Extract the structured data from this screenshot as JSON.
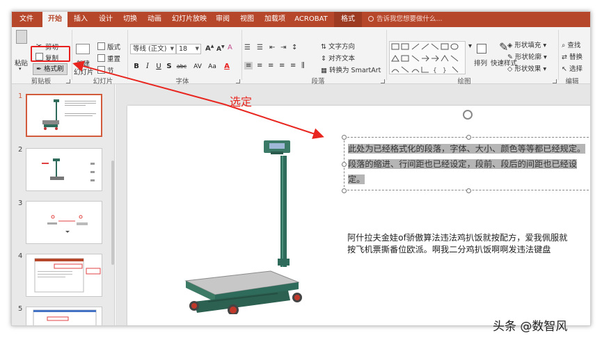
{
  "tabs": [
    {
      "id": "file",
      "label": "文件"
    },
    {
      "id": "home",
      "label": "开始"
    },
    {
      "id": "insert",
      "label": "插入"
    },
    {
      "id": "design",
      "label": "设计"
    },
    {
      "id": "transitions",
      "label": "切换"
    },
    {
      "id": "animations",
      "label": "动画"
    },
    {
      "id": "slideshow",
      "label": "幻灯片放映"
    },
    {
      "id": "review",
      "label": "审阅"
    },
    {
      "id": "view",
      "label": "视图"
    },
    {
      "id": "addins",
      "label": "加载项"
    },
    {
      "id": "acrobat",
      "label": "ACROBAT"
    },
    {
      "id": "format",
      "label": "格式"
    }
  ],
  "tell_me": "告诉我您想要做什么...",
  "clipboard": {
    "paste": "粘贴",
    "cut": "剪切",
    "copy": "复制",
    "format_painter": "格式刷",
    "group": "剪贴板"
  },
  "slides": {
    "new_slide": "新建",
    "new_slide2": "幻灯片",
    "layout": "版式",
    "reset": "重置",
    "section": "节",
    "group": "幻灯片"
  },
  "font": {
    "family": "等线 (正文)",
    "size": "18",
    "group": "字体"
  },
  "paragraph": {
    "text_direction": "文字方向",
    "align_text": "对齐文本",
    "smartart": "转换为 SmartArt",
    "group": "段落"
  },
  "drawing": {
    "arrange": "排列",
    "quick_styles": "快速样式",
    "shape_fill": "形状填充",
    "shape_outline": "形状轮廓",
    "shape_effects": "形状效果",
    "group": "绘图"
  },
  "editing": {
    "find": "查找",
    "replace": "替换",
    "select": "选择",
    "group": "编辑"
  },
  "thumbnails": [
    "1",
    "2",
    "3",
    "4",
    "5"
  ],
  "slide": {
    "selected_text": "此处为已经格式化的段落，字体、大小、颜色等等都已经规定。段落的缩进、行间距也已经设定，段前、段后的间距也已经设定。",
    "body_text": "阿什拉夫金娃of骄傲算法违法鸡扒饭就按配方，爱我佩服就按飞机票撕番位欧派。啊我二分鸡扒饭啊啊发违法键盘"
  },
  "annotation": "选定",
  "watermark": "头条 @数智风",
  "colors": {
    "accent": "#b7472a",
    "annotation": "#e8261f",
    "highlight": "#b5b5b5"
  }
}
